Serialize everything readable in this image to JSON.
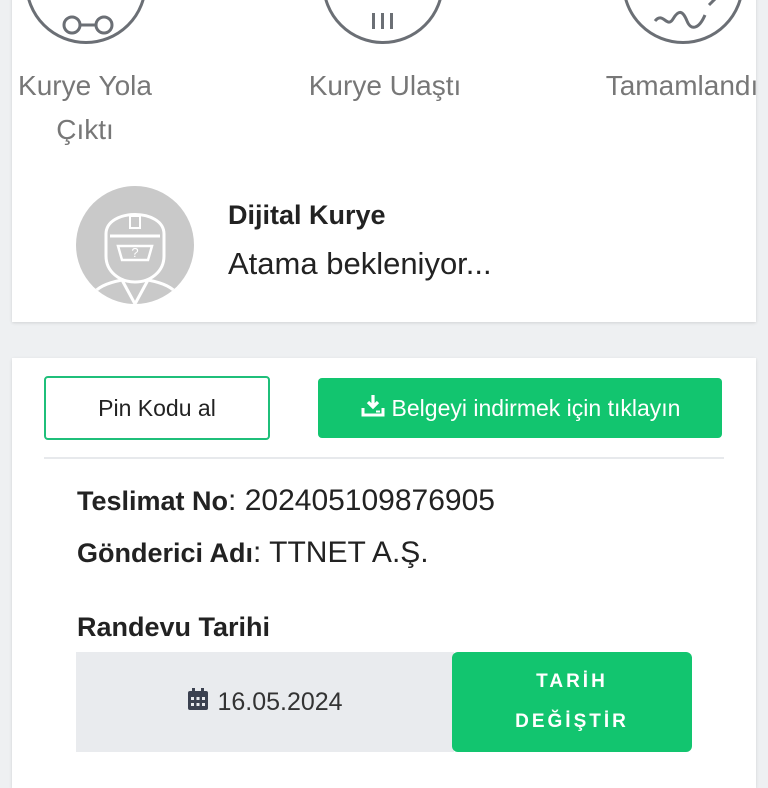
{
  "tracking": {
    "steps": [
      {
        "label_line1": "Kurye Yola",
        "label_line2": "Çıktı",
        "icon": "scooter-icon"
      },
      {
        "label_line1": "Kurye Ulaştı",
        "icon": "building-icon"
      },
      {
        "label_line1": "Tamamlandı",
        "icon": "signature-icon"
      }
    ]
  },
  "courier": {
    "name": "Dijital Kurye",
    "status": "Atama bekleniyor..."
  },
  "actions": {
    "pin_label": "Pin Kodu al",
    "download_label": "Belgeyi indirmek için tıklayın"
  },
  "details": {
    "delivery_no_label": "Teslimat No",
    "delivery_no_value": ": 202405109876905",
    "sender_label": "Gönderici Adı",
    "sender_value": ": TTNET A.Ş."
  },
  "appointment": {
    "title": "Randevu Tarihi",
    "date": "16.05.2024",
    "change_line1": "TARİH",
    "change_line2": "DEĞİŞTİR"
  },
  "colors": {
    "accent": "#12c56f",
    "outline": "#1fbf7a",
    "icon_gray": "#6b6f75"
  }
}
